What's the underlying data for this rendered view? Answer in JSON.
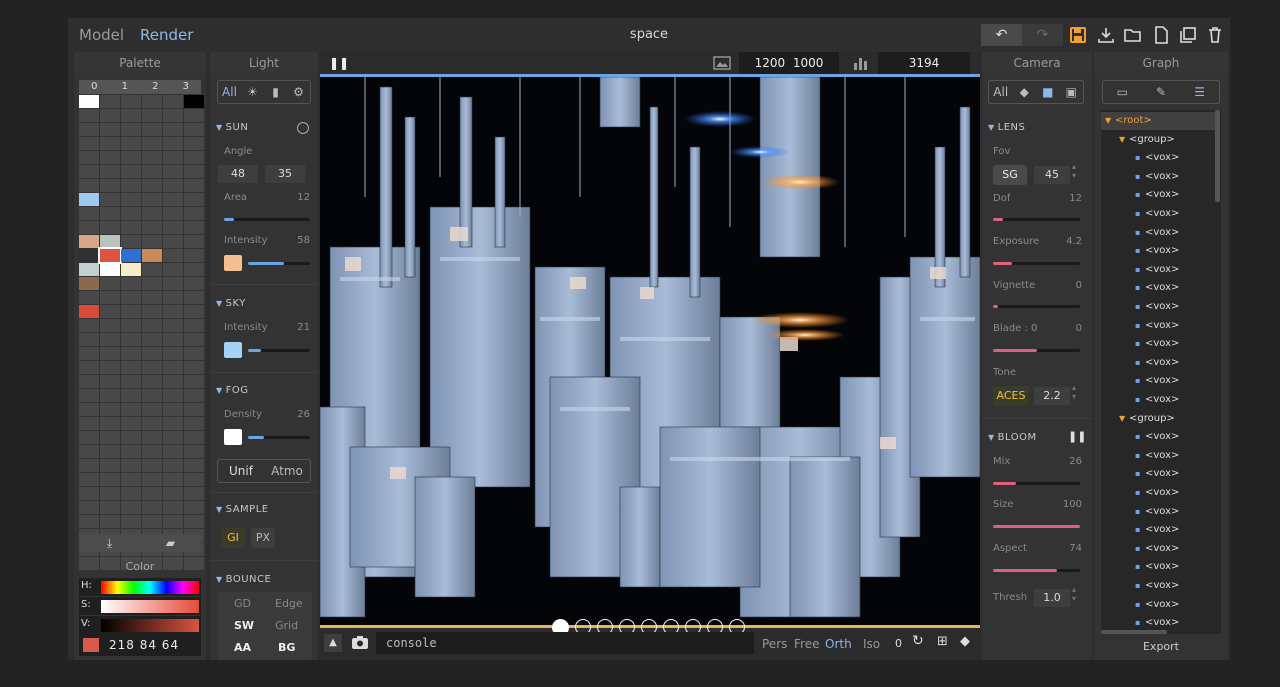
{
  "topbar": {
    "mode_model": "Model",
    "mode_render": "Render",
    "title": "space",
    "undo": "↶",
    "redo": "↷"
  },
  "palette": {
    "title": "Palette",
    "columns": [
      "0",
      "1",
      "2",
      "3"
    ],
    "color_label": "Color",
    "hsv": {
      "h": "H:",
      "s": "S:",
      "v": "V:"
    },
    "rgb_value": "218 84 64",
    "selected_color": "#da5440"
  },
  "light": {
    "title": "Light",
    "filter_all": "All",
    "sun": {
      "title": "SUN",
      "angle_label": "Angle",
      "angle_a": "48",
      "angle_b": "35",
      "area_label": "Area",
      "area_value": "12",
      "area_level": 0.12,
      "intensity_label": "Intensity",
      "intensity_value": "58",
      "intensity_level": 0.58,
      "color": "#f4c08f"
    },
    "sky": {
      "title": "SKY",
      "intensity_label": "Intensity",
      "intensity_value": "21",
      "intensity_level": 0.21,
      "color": "#a6d1f7"
    },
    "fog": {
      "title": "FOG",
      "density_label": "Density",
      "density_value": "26",
      "density_level": 0.26,
      "color": "#ffffff",
      "unif": "Unif",
      "atmo": "Atmo"
    },
    "sample": {
      "title": "SAMPLE",
      "gi": "GI",
      "px": "PX"
    },
    "bounce": {
      "title": "BOUNCE",
      "gd": "GD",
      "edge": "Edge",
      "sw": "SW",
      "grid": "Grid",
      "aa": "AA",
      "bg": "BG"
    }
  },
  "viewport": {
    "width": "1200",
    "height": "1000",
    "samples": "3194",
    "console_placeholder": "console",
    "cam_modes": [
      "Pers",
      "Free",
      "Orth",
      "Iso"
    ],
    "active_mode": "Orth",
    "zero": "0"
  },
  "camera": {
    "title": "Camera",
    "filter_all": "All",
    "lens": {
      "title": "LENS",
      "fov_label": "Fov",
      "fov_btn": "SG",
      "fov_value": "45",
      "dof_label": "Dof",
      "dof_value": "12",
      "dof_level": 0.12,
      "exposure_label": "Exposure",
      "exposure_value": "4.2",
      "exposure_level": 0.22,
      "vignette_label": "Vignette",
      "vignette_value": "0",
      "vignette_level": 0.0,
      "blade_label": "Blade : 0",
      "blade_value": "0",
      "blade_level": 0.5,
      "tone_label": "Tone",
      "tone_btn": "ACES",
      "tone_value": "2.2"
    },
    "bloom": {
      "title": "BLOOM",
      "mix_label": "Mix",
      "mix_value": "26",
      "mix_level": 0.26,
      "size_label": "Size",
      "size_value": "100",
      "size_level": 1.0,
      "aspect_label": "Aspect",
      "aspect_value": "74",
      "aspect_level": 0.74,
      "thresh_label": "Thresh",
      "thresh_value": "1.0"
    }
  },
  "graph": {
    "title": "Graph",
    "root": "<root>",
    "group": "<group>",
    "vox": "<vox>",
    "export": "Export"
  }
}
